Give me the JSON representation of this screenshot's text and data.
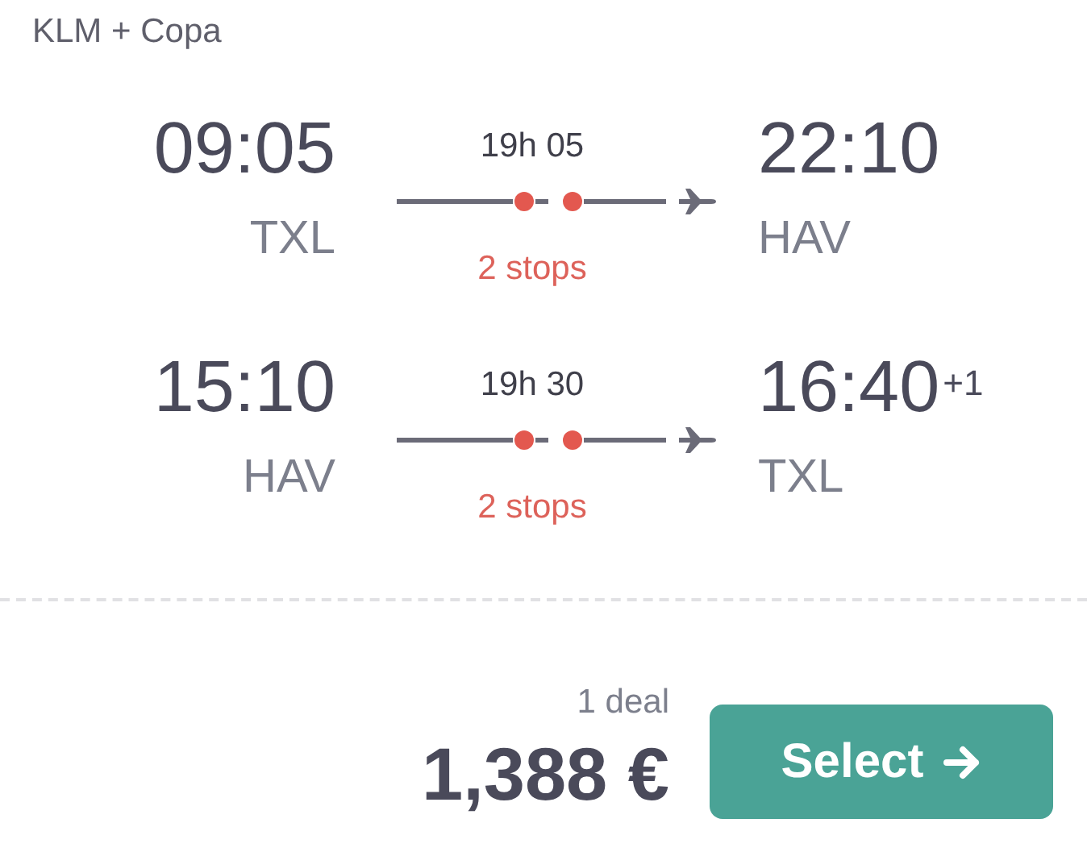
{
  "carrier": "KLM + Copa",
  "legs": [
    {
      "departure_time": "09:05",
      "departure_airport": "TXL",
      "duration": "19h 05",
      "stops": "2 stops",
      "arrival_time": "22:10",
      "arrival_airport": "HAV"
    },
    {
      "departure_time": "15:10",
      "departure_airport": "HAV",
      "duration": "19h 30",
      "stops": "2 stops",
      "arrival_time": "16:40",
      "day_offset": "+1",
      "arrival_airport": "TXL"
    }
  ],
  "deals": "1 deal",
  "price": "1,388 €",
  "select_button": "Select"
}
